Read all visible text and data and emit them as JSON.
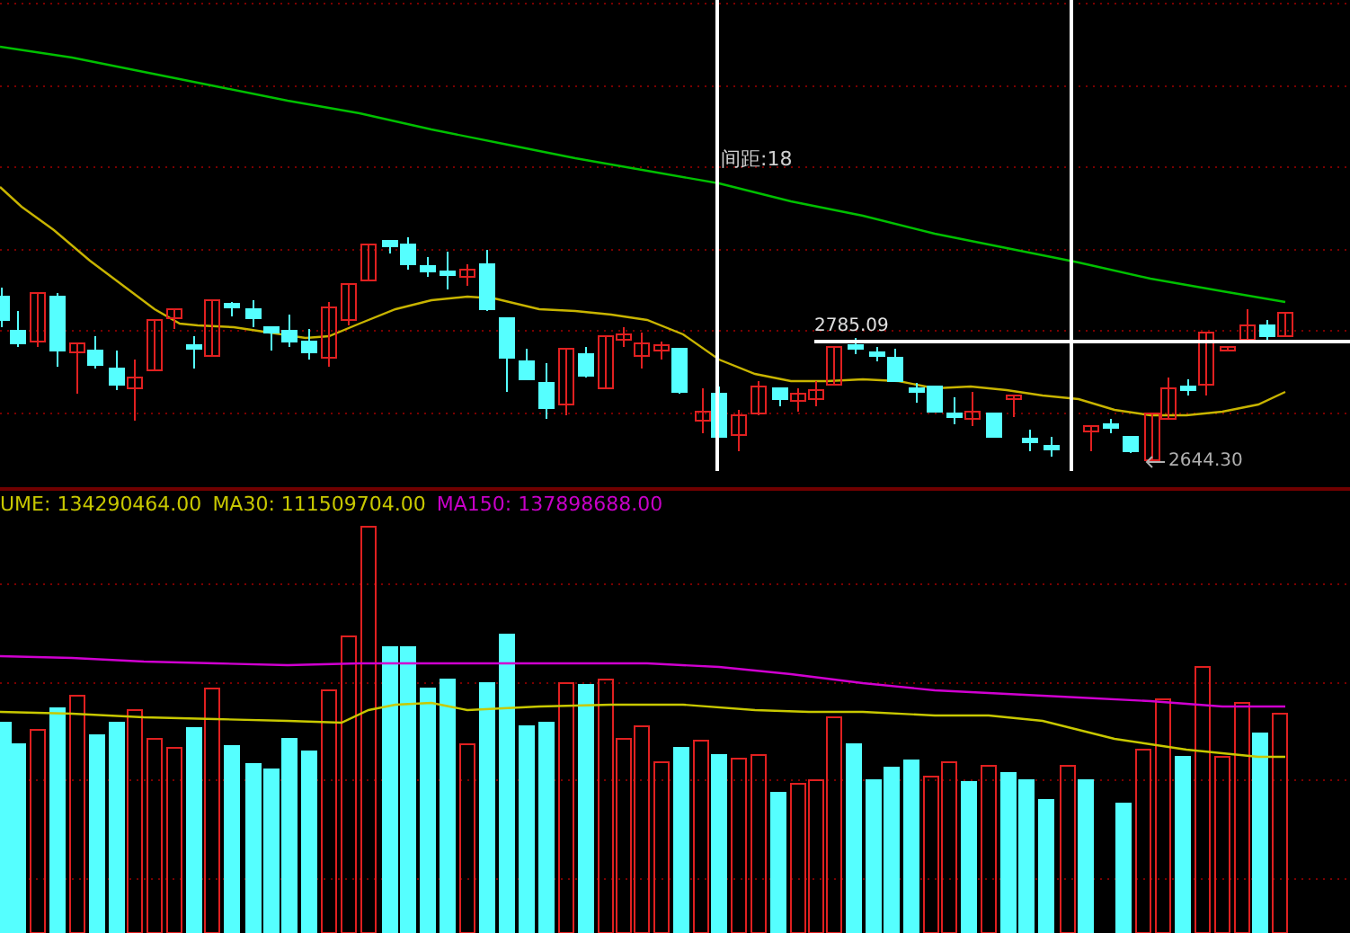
{
  "price_chart": {
    "distance_label": "间距:18",
    "high_label": "2785.09",
    "low_label": "2644.30"
  },
  "volume_legend": [
    {
      "text": "UME: 134290464.00",
      "color": "#c8c800"
    },
    {
      "text": "MA30: 111509704.00",
      "color": "#c8c800"
    },
    {
      "text": "MA150: 137898688.00",
      "color": "#c800c8"
    }
  ]
}
